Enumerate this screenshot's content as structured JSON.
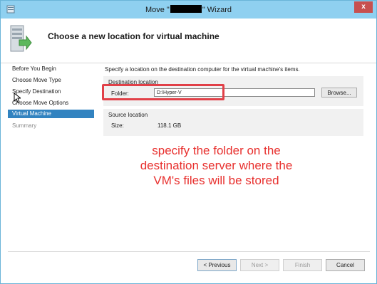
{
  "window": {
    "title_prefix": "Move \"",
    "title_suffix": "\" Wizard",
    "close_label": "x"
  },
  "header": {
    "title": "Choose a new location for virtual machine"
  },
  "nav": {
    "items": [
      {
        "label": "Before You Begin",
        "state": "normal"
      },
      {
        "label": "Choose Move Type",
        "state": "normal"
      },
      {
        "label": "Specify Destination",
        "state": "normal"
      },
      {
        "label": "Choose Move Options",
        "state": "normal"
      },
      {
        "label": "Virtual Machine",
        "state": "active"
      },
      {
        "label": "Summary",
        "state": "disabled"
      }
    ]
  },
  "content": {
    "intro": "Specify a location on the destination computer for the virtual machine's items.",
    "destination": {
      "group_title": "Destination location",
      "folder_label": "Folder:",
      "folder_value": "D:\\Hyper-V",
      "browse_label": "Browse..."
    },
    "source": {
      "group_title": "Source location",
      "size_label": "Size:",
      "size_value": "118.1 GB"
    }
  },
  "annotation": {
    "text": "specify the folder on the destination server where the VM's files will be stored"
  },
  "footer": {
    "previous": "< Previous",
    "next": "Next >",
    "finish": "Finish",
    "cancel": "Cancel"
  },
  "colors": {
    "titlebar": "#8fd0f0",
    "nav_active": "#3283c0",
    "annotation": "#e8302e",
    "highlight_border": "#e14048"
  }
}
